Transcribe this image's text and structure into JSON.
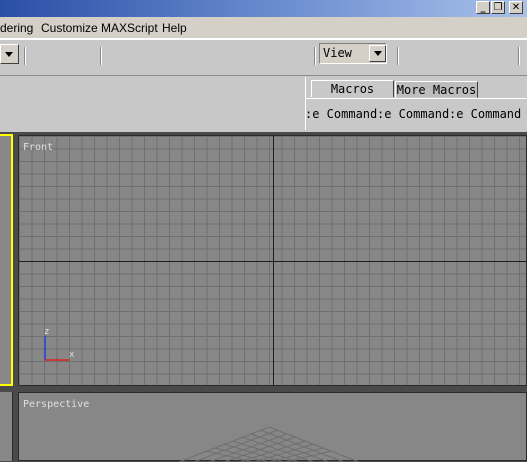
{
  "menubar": {
    "items": [
      "dering",
      "Customize",
      "MAXScript",
      "Help"
    ]
  },
  "titlebar": {
    "buttons": [
      "minimize",
      "restore",
      "close"
    ]
  },
  "toolbar": {
    "view_combo_value": "View"
  },
  "command_panel": {
    "tabs": [
      "Macros",
      "More Macros"
    ],
    "commands": [
      ":e Command",
      ":e Command",
      ":e Command"
    ]
  },
  "viewports": {
    "front_label": "Front",
    "perspective_label": "Perspective",
    "axis_z": "z",
    "axis_x": "x"
  },
  "colors": {
    "viewport_bg": "#878787",
    "grid_line": "#6f6f6f",
    "active_viewport_border": "#ffff00",
    "axis_x": "#e02020",
    "axis_z": "#2040e0"
  }
}
